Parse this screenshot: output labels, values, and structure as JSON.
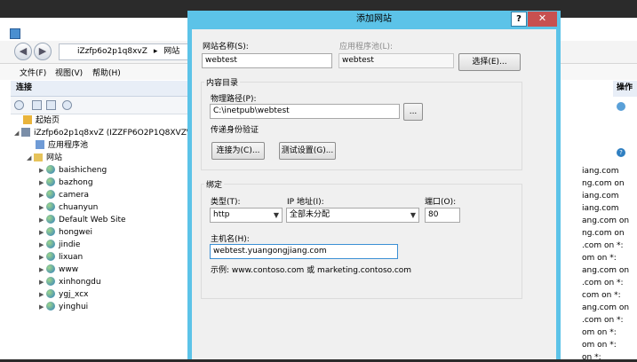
{
  "iis": {
    "address_node": "iZzfp6o2p1q8xvZ",
    "address_sep": "▸",
    "address_section": "网站",
    "menu": [
      "文件(F)",
      "视图(V)",
      "帮助(H)"
    ],
    "connections_header": "连接",
    "ops_header": "操作",
    "tree": {
      "start_page": "起始页",
      "server": "iZzfp6o2p1q8xvZ (IZZFP6O2P1Q8XVZ\\Ad",
      "app_pools": "应用程序池",
      "sites_folder": "网站",
      "sites": [
        "baishicheng",
        "bazhong",
        "camera",
        "chuanyun",
        "Default Web Site",
        "hongwei",
        "jindie",
        "lixuan",
        "www",
        "xinhongdu",
        "ygj_xcx",
        "yinghui"
      ]
    },
    "bindings_peek": [
      "iang.com",
      "ng.com on",
      "iang.com",
      "iang.com",
      "ang.com on",
      "ng.com on",
      ".com on *:",
      "om on *:",
      "ang.com on",
      ".com on *:",
      "com on *:",
      "ang.com on",
      ".com on *:",
      "om on *:",
      "om on *:",
      "on *:"
    ]
  },
  "dialog": {
    "title": "添加网站",
    "help": "?",
    "close": "✕",
    "site_name_label": "网站名称(S):",
    "site_name_value": "webtest",
    "app_pool_label": "应用程序池(L):",
    "app_pool_value": "webtest",
    "select_button": "选择(E)...",
    "content_dir_label": "内容目录",
    "physical_path_label": "物理路径(P):",
    "physical_path_value": "C:\\inetpub\\webtest",
    "browse_button": "...",
    "passthrough_label": "传递身份验证",
    "connect_as_button": "连接为(C)...",
    "test_settings_button": "测试设置(G)...",
    "binding_label": "绑定",
    "type_label": "类型(T):",
    "type_value": "http",
    "ip_label": "IP 地址(I):",
    "ip_value": "全部未分配",
    "port_label": "端口(O):",
    "port_value": "80",
    "hostname_label": "主机名(H):",
    "hostname_value": "webtest.yuangongjiang.com",
    "example_text": "示例: www.contoso.com 或 marketing.contoso.com"
  }
}
